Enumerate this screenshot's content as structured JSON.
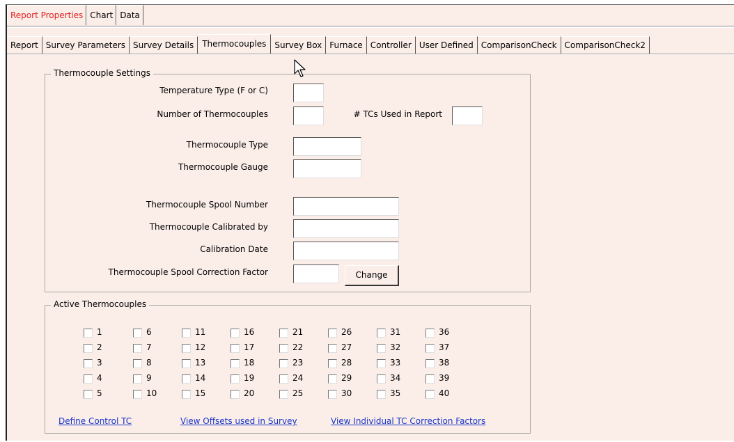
{
  "top_tabs": [
    {
      "label": "Report Properties"
    },
    {
      "label": "Chart"
    },
    {
      "label": "Data"
    }
  ],
  "sub_tabs": [
    {
      "label": "Report"
    },
    {
      "label": "Survey Parameters"
    },
    {
      "label": "Survey Details"
    },
    {
      "label": "Thermocouples"
    },
    {
      "label": "Survey Box"
    },
    {
      "label": "Furnace"
    },
    {
      "label": "Controller"
    },
    {
      "label": "User Defined"
    },
    {
      "label": "ComparisonCheck"
    },
    {
      "label": "ComparisonCheck2"
    }
  ],
  "settings": {
    "legend": "Thermocouple Settings",
    "temp_type_label": "Temperature Type (F or C)",
    "temp_type_value": "",
    "num_tc_label": "Number of Thermocouples",
    "num_tc_value": "",
    "tcs_used_label": "# TCs Used in Report",
    "tcs_used_value": "",
    "tc_type_label": "Thermocouple Type",
    "tc_type_value": "",
    "tc_gauge_label": "Thermocouple Gauge",
    "tc_gauge_value": "",
    "spool_number_label": "Thermocouple Spool Number",
    "spool_number_value": "",
    "calibrated_by_label": "Thermocouple Calibrated by",
    "calibrated_by_value": "",
    "cal_date_label": "Calibration Date",
    "cal_date_value": "",
    "spool_factor_label": "Thermocouple Spool Correction Factor",
    "spool_factor_value": "",
    "change_button": "Change"
  },
  "active": {
    "legend": "Active Thermocouples",
    "checkboxes": [
      "1",
      "2",
      "3",
      "4",
      "5",
      "6",
      "7",
      "8",
      "9",
      "10",
      "11",
      "12",
      "13",
      "14",
      "15",
      "16",
      "17",
      "18",
      "19",
      "20",
      "21",
      "22",
      "23",
      "24",
      "25",
      "26",
      "27",
      "28",
      "29",
      "30",
      "31",
      "32",
      "33",
      "34",
      "35",
      "36",
      "37",
      "38",
      "39",
      "40"
    ],
    "links": {
      "define_control": "Define Control TC",
      "view_offsets": "View Offsets used in Survey",
      "view_correction": "View Individual TC Correction Factors"
    }
  }
}
